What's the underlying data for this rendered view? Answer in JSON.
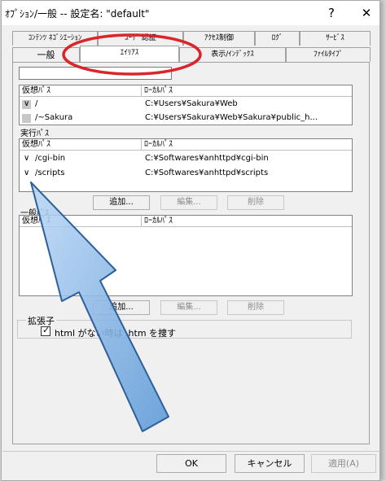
{
  "dialog": {
    "title": "ｵﾌﾟｼｮﾝ/一般 -- 設定名: \"default\"",
    "help_icon": "?",
    "close_icon": "✕"
  },
  "tabs": {
    "row1": [
      "ｺﾝﾃﾝﾂ ﾈｺﾞｼｴｰｼｮﾝ",
      "ﾕｰｻﾞ 認証",
      "ｱｸｾｽ制御",
      "ﾛｸﾞ",
      "ｻｰﾋﾞｽ"
    ],
    "row2": [
      "一般",
      "ｴｲﾘｱｽ",
      "表示/ｲﾝﾃﾞｯｸｽ",
      "ﾌｧｲﾙﾀｲﾌﾟ"
    ],
    "selected": "ｴｲﾘｱｽ"
  },
  "virtual_paths": {
    "col_virtual": "仮想ﾊﾟｽ",
    "col_local": "ﾛｰｶﾙﾊﾟｽ",
    "rows": [
      {
        "mark": "∨",
        "virtual": "/",
        "local": "C:¥Users¥Sakura¥Web"
      },
      {
        "mark": "",
        "virtual": "/~Sakura",
        "local": "C:¥Users¥Sakura¥Web¥Sakura¥public_h..."
      }
    ]
  },
  "exec_paths": {
    "label": "実行ﾊﾟｽ",
    "col_virtual": "仮想ﾊﾟｽ",
    "col_local": "ﾛｰｶﾙﾊﾟｽ",
    "rows": [
      {
        "mark": "∨",
        "virtual": "/cgi-bin",
        "local": "C:¥Softwares¥anhttpd¥cgi-bin"
      },
      {
        "mark": "∨",
        "virtual": "/scripts",
        "local": "C:¥Softwares¥anhttpd¥scripts"
      }
    ],
    "buttons": {
      "add": "追加...",
      "edit": "編集...",
      "delete": "削除"
    }
  },
  "general_paths": {
    "label": "一般ﾊﾟｽ",
    "col_virtual": "仮想ﾊﾟｽ",
    "col_local": "ﾛｰｶﾙﾊﾟｽ",
    "buttons": {
      "add": "追加...",
      "edit": "編集...",
      "delete": "削除"
    }
  },
  "extension": {
    "label": "拡張子",
    "checkbox_label": "html がない時は .htm を捜す",
    "checked": true
  },
  "footer": {
    "ok": "OK",
    "cancel": "キャンセル",
    "apply": "適用(A)"
  },
  "annotation_colors": {
    "ellipse": "#d9262b",
    "arrow_fill": "#7fb3e8",
    "arrow_stroke": "#2d5f9a"
  }
}
